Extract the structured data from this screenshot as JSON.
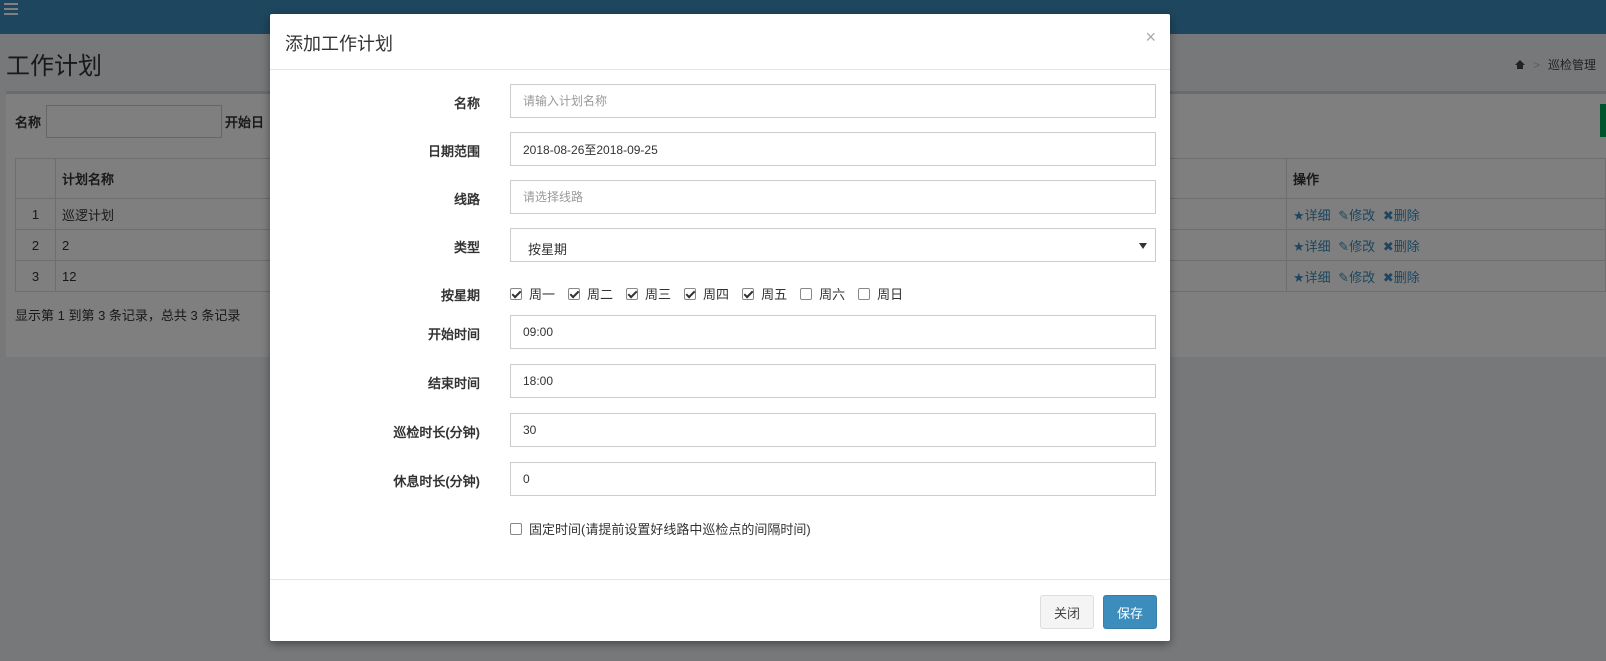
{
  "page": {
    "title": "工作计划",
    "breadcrumb": {
      "separator": ">",
      "current": "巡检管理"
    }
  },
  "search": {
    "name_label": "名称",
    "start_date_label": "开始日"
  },
  "table": {
    "headers": [
      "",
      "计划名称",
      "操作"
    ],
    "rows": [
      {
        "index": "1",
        "name": "巡逻计划"
      },
      {
        "index": "2",
        "name": "2"
      },
      {
        "index": "3",
        "name": "12"
      }
    ],
    "actions": {
      "detail": "★详细",
      "edit": "✎修改",
      "delete": "✖删除"
    }
  },
  "pager": {
    "info": "显示第 1 到第 3 条记录，总共 3 条记录"
  },
  "modal": {
    "title": "添加工作计划",
    "close_symbol": "×",
    "fields": {
      "name": {
        "label": "名称",
        "placeholder": "请输入计划名称"
      },
      "date_range": {
        "label": "日期范围",
        "value": "2018-08-26至2018-09-25"
      },
      "route": {
        "label": "线路",
        "placeholder": "请选择线路"
      },
      "type": {
        "label": "类型",
        "value": "按星期"
      },
      "week": {
        "label": "按星期",
        "days": [
          {
            "label": "周一",
            "checked": true
          },
          {
            "label": "周二",
            "checked": true
          },
          {
            "label": "周三",
            "checked": true
          },
          {
            "label": "周四",
            "checked": true
          },
          {
            "label": "周五",
            "checked": true
          },
          {
            "label": "周六",
            "checked": false
          },
          {
            "label": "周日",
            "checked": false
          }
        ]
      },
      "start_time": {
        "label": "开始时间",
        "value": "09:00"
      },
      "end_time": {
        "label": "结束时间",
        "value": "18:00"
      },
      "patrol_duration": {
        "label": "巡检时长(分钟)",
        "value": "30"
      },
      "rest_duration": {
        "label": "休息时长(分钟)",
        "value": "0"
      },
      "fixed_time": {
        "label": "固定时间(请提前设置好线路中巡检点的间隔时间)",
        "checked": false
      }
    },
    "buttons": {
      "close": "关闭",
      "save": "保存"
    }
  },
  "colors": {
    "primary": "#3c8dbc",
    "header_bg": "#3c8dbc",
    "success": "#00a65a"
  }
}
